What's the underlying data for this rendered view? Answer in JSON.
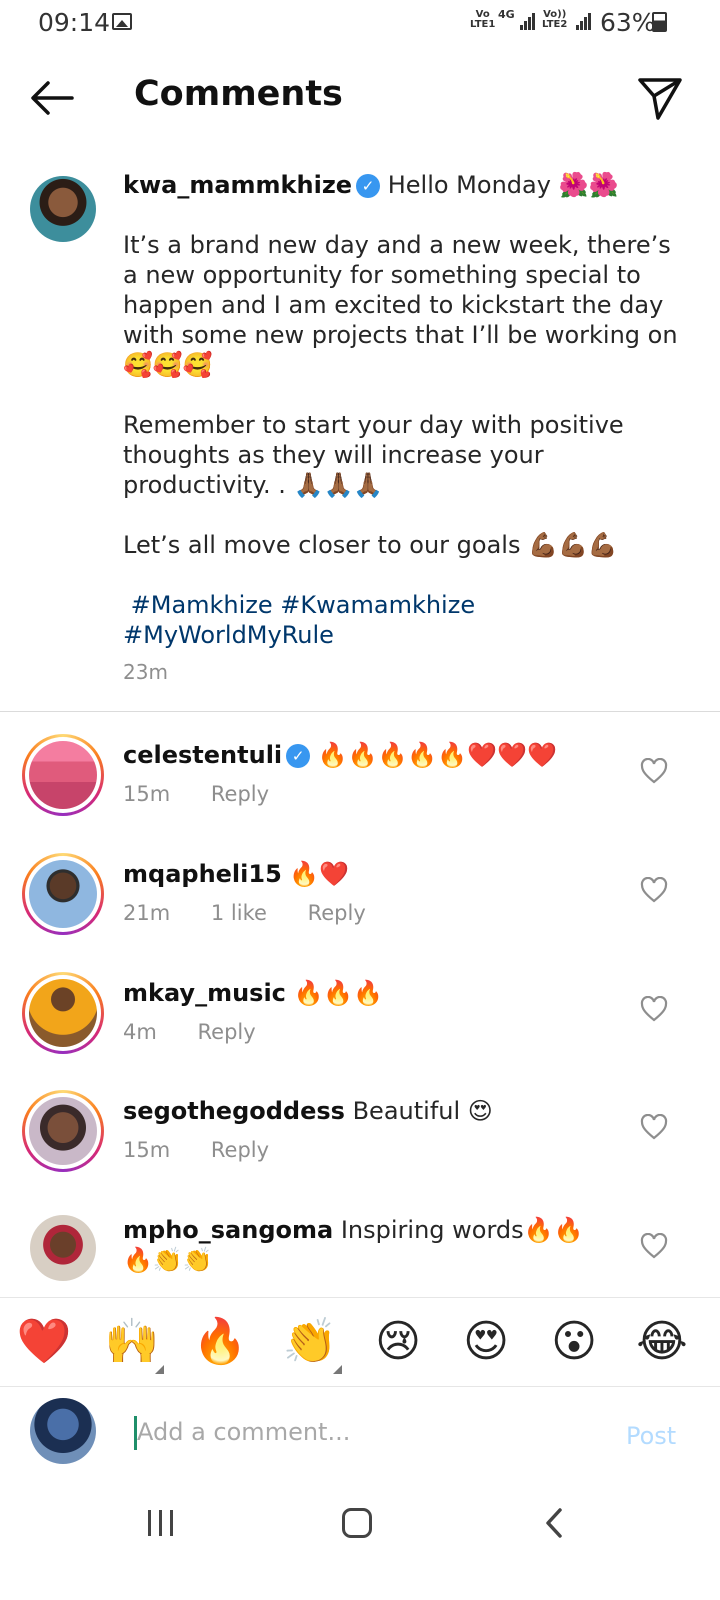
{
  "status_bar": {
    "time": "09:14",
    "sim1_top": "Vo",
    "sim1_bottom": "LTE1",
    "network": "4G",
    "sim2_top": "Vo))",
    "sim2_bottom": "LTE2",
    "battery": "63%"
  },
  "header": {
    "title": "Comments",
    "back_icon": "arrow-left-icon",
    "share_icon": "paper-plane-icon"
  },
  "caption": {
    "username": "kwa_mammkhize",
    "verified": true,
    "first_line": "Hello Monday 🌺🌺",
    "paragraph1": "It’s a brand new day and a new week, there’s a new opportunity for something special to happen and I am excited to kickstart the day with some new projects that I’ll be working on 🥰🥰🥰",
    "paragraph2": "Remember to start your day with positive thoughts as they will increase your productivity. . 🙏🏾🙏🏾🙏🏾",
    "paragraph3": "Let’s all move closer to our goals 💪🏾💪🏾💪🏾",
    "hashtags_line1": " #Mamkhize #Kwamamkhize",
    "hashtags_line2": "#MyWorldMyRule",
    "time": "23m"
  },
  "comments": [
    {
      "username": "celestentuli",
      "verified": true,
      "text": "🔥🔥🔥🔥🔥❤️❤️❤️",
      "time": "15m",
      "likes": "",
      "reply": "Reply",
      "story_ring": true
    },
    {
      "username": "mqapheli15",
      "verified": false,
      "text": "🔥❤️",
      "time": "21m",
      "likes": "1 like",
      "reply": "Reply",
      "story_ring": true
    },
    {
      "username": "mkay_music",
      "verified": false,
      "text": "🔥🔥🔥",
      "time": "4m",
      "likes": "",
      "reply": "Reply",
      "story_ring": true
    },
    {
      "username": "segothegoddess",
      "verified": false,
      "text": "Beautiful 😍",
      "time": "15m",
      "likes": "",
      "reply": "Reply",
      "story_ring": true
    },
    {
      "username": "mpho_sangoma",
      "verified": false,
      "text": "Inspiring words🔥🔥🔥👏👏",
      "time": "",
      "likes": "",
      "reply": "",
      "story_ring": false
    }
  ],
  "emoji_bar": [
    "❤️",
    "🙌",
    "🔥",
    "👏",
    "😢",
    "😍",
    "😮",
    "😂"
  ],
  "composer": {
    "placeholder": "Add a comment...",
    "post_label": "Post"
  },
  "colors": {
    "verified": "#3897f0",
    "hashtag": "#00376b",
    "post_disabled": "#b3dbff",
    "meta_gray": "#8e8e8e"
  }
}
